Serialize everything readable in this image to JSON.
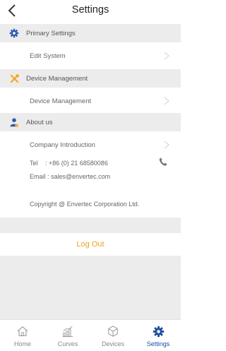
{
  "header": {
    "title": "Settings"
  },
  "sections": {
    "primary": {
      "label": "Primary Settings",
      "icon": "gear-icon"
    },
    "device": {
      "label": "Device Management",
      "icon": "tools-icon"
    },
    "about": {
      "label": "About us",
      "icon": "person-icon"
    }
  },
  "rows": {
    "edit_system": "Edit System",
    "device_management": "Device Management",
    "company_intro": "Company Introduction"
  },
  "contact": {
    "tel_label": "Tel",
    "tel_value": ": +86 (0) 21 68580086",
    "email": "Email : sales@envertec.com",
    "copyright": "Copyright @ Envertec Corporation Ltd."
  },
  "logout_label": "Log Out",
  "tabs": [
    {
      "label": "Home",
      "icon": "home-icon"
    },
    {
      "label": "Curves",
      "icon": "bar-chart-icon"
    },
    {
      "label": "Devices",
      "icon": "device-icon"
    },
    {
      "label": "Settings",
      "icon": "gear-icon",
      "active": true
    }
  ],
  "colors": {
    "accent": "#f0a020",
    "active_tab": "#1e4fa0",
    "section_icon": "#2a5bb0",
    "tools_icon": "#f5a623"
  }
}
